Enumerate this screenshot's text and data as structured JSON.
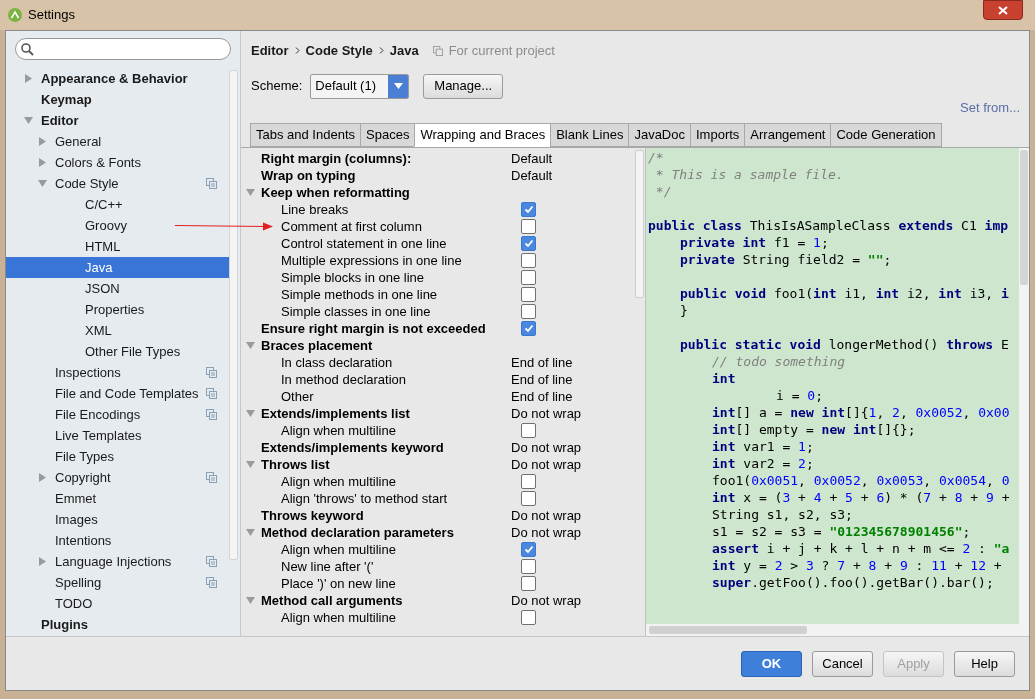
{
  "window": {
    "title": "Settings"
  },
  "sidebar": {
    "items": [
      {
        "label": "Appearance & Behavior",
        "expanded": false,
        "selected": false
      },
      {
        "label": "Keymap",
        "selected": false
      },
      {
        "label": "Editor",
        "expanded": true,
        "selected": false,
        "children": [
          {
            "label": "General",
            "expanded": false,
            "selected": false
          },
          {
            "label": "Colors & Fonts",
            "expanded": false,
            "selected": false
          },
          {
            "label": "Code Style",
            "expanded": true,
            "project_icon": true,
            "selected": false,
            "children": [
              {
                "label": "C/C++",
                "selected": false
              },
              {
                "label": "Groovy",
                "selected": false
              },
              {
                "label": "HTML",
                "selected": false
              },
              {
                "label": "Java",
                "selected": true
              },
              {
                "label": "JSON",
                "selected": false
              },
              {
                "label": "Properties",
                "selected": false
              },
              {
                "label": "XML",
                "selected": false
              },
              {
                "label": "Other File Types",
                "selected": false
              }
            ]
          },
          {
            "label": "Inspections",
            "project_icon": true,
            "selected": false
          },
          {
            "label": "File and Code Templates",
            "project_icon": true,
            "selected": false
          },
          {
            "label": "File Encodings",
            "project_icon": true,
            "selected": false
          },
          {
            "label": "Live Templates",
            "selected": false
          },
          {
            "label": "File Types",
            "selected": false
          },
          {
            "label": "Copyright",
            "expanded": false,
            "project_icon": true,
            "selected": false
          },
          {
            "label": "Emmet",
            "selected": false
          },
          {
            "label": "Images",
            "selected": false
          },
          {
            "label": "Intentions",
            "selected": false
          },
          {
            "label": "Language Injections",
            "expanded": false,
            "project_icon": true,
            "selected": false
          },
          {
            "label": "Spelling",
            "project_icon": true,
            "selected": false
          },
          {
            "label": "TODO",
            "selected": false
          }
        ]
      },
      {
        "label": "Plugins",
        "selected": false
      }
    ]
  },
  "breadcrumb": [
    "Editor",
    "Code Style",
    "Java"
  ],
  "scope_note": "For current project",
  "scheme": {
    "label": "Scheme:",
    "value": "Default (1)",
    "manage_button": "Manage..."
  },
  "set_from_link": "Set from...",
  "tabs": [
    {
      "label": "Tabs and Indents",
      "selected": false
    },
    {
      "label": "Spaces",
      "selected": false
    },
    {
      "label": "Wrapping and Braces",
      "selected": true
    },
    {
      "label": "Blank Lines",
      "selected": false
    },
    {
      "label": "JavaDoc",
      "selected": false
    },
    {
      "label": "Imports",
      "selected": false
    },
    {
      "label": "Arrangement",
      "selected": false
    },
    {
      "label": "Code Generation",
      "selected": false
    }
  ],
  "options": [
    {
      "kind": "value",
      "label": "Right margin (columns):",
      "value": "Default"
    },
    {
      "kind": "value",
      "label": "Wrap on typing",
      "value": "Default"
    },
    {
      "kind": "group",
      "label": "Keep when reformatting",
      "expanded": true,
      "children": [
        {
          "kind": "checkbox",
          "label": "Line breaks",
          "checked": true
        },
        {
          "kind": "checkbox",
          "label": "Comment at first column",
          "checked": false
        },
        {
          "kind": "checkbox",
          "label": "Control statement in one line",
          "checked": true
        },
        {
          "kind": "checkbox",
          "label": "Multiple expressions in one line",
          "checked": false
        },
        {
          "kind": "checkbox",
          "label": "Simple blocks in one line",
          "checked": false
        },
        {
          "kind": "checkbox",
          "label": "Simple methods in one line",
          "checked": false
        },
        {
          "kind": "checkbox",
          "label": "Simple classes in one line",
          "checked": false
        }
      ]
    },
    {
      "kind": "checkbox",
      "label": "Ensure right margin is not exceeded",
      "checked": true
    },
    {
      "kind": "group",
      "label": "Braces placement",
      "expanded": true,
      "children": [
        {
          "kind": "value",
          "label": "In class declaration",
          "value": "End of line"
        },
        {
          "kind": "value",
          "label": "In method declaration",
          "value": "End of line"
        },
        {
          "kind": "value",
          "label": "Other",
          "value": "End of line"
        }
      ]
    },
    {
      "kind": "group",
      "label": "Extends/implements list",
      "value": "Do not wrap",
      "expanded": true,
      "children": [
        {
          "kind": "checkbox",
          "label": "Align when multiline",
          "checked": false
        }
      ]
    },
    {
      "kind": "value",
      "label": "Extends/implements keyword",
      "value": "Do not wrap"
    },
    {
      "kind": "group",
      "label": "Throws list",
      "value": "Do not wrap",
      "expanded": true,
      "children": [
        {
          "kind": "checkbox",
          "label": "Align when multiline",
          "checked": false
        },
        {
          "kind": "checkbox",
          "label": "Align 'throws' to method start",
          "checked": false
        }
      ]
    },
    {
      "kind": "value",
      "label": "Throws keyword",
      "value": "Do not wrap"
    },
    {
      "kind": "group",
      "label": "Method declaration parameters",
      "value": "Do not wrap",
      "expanded": true,
      "children": [
        {
          "kind": "checkbox",
          "label": "Align when multiline",
          "checked": true
        },
        {
          "kind": "checkbox",
          "label": "New line after '('",
          "checked": false
        },
        {
          "kind": "checkbox",
          "label": "Place ')' on new line",
          "checked": false
        }
      ]
    },
    {
      "kind": "group",
      "label": "Method call arguments",
      "value": "Do not wrap",
      "expanded": true,
      "children": [
        {
          "kind": "checkbox",
          "label": "Align when multiline",
          "checked": false
        }
      ]
    }
  ],
  "code_lines": [
    {
      "kind": "code",
      "segments": [
        {
          "kind": "comment",
          "text": "/*"
        }
      ]
    },
    {
      "kind": "code",
      "segments": [
        {
          "kind": "comment",
          "text": " * This is a sample file."
        }
      ]
    },
    {
      "kind": "code",
      "segments": [
        {
          "kind": "comment",
          "text": " */"
        }
      ]
    },
    {
      "kind": "blank"
    },
    {
      "kind": "code",
      "segments": [
        {
          "kind": "keyword",
          "text": "public class "
        },
        {
          "kind": "plain",
          "text": "ThisIsASampleClass "
        },
        {
          "kind": "keyword",
          "text": "extends "
        },
        {
          "kind": "plain",
          "text": "C1 "
        },
        {
          "kind": "keyword",
          "text": "imp"
        }
      ]
    },
    {
      "kind": "indent1",
      "segments": [
        {
          "kind": "keyword",
          "text": "private int "
        },
        {
          "kind": "plain",
          "text": "f1 = "
        },
        {
          "kind": "number",
          "text": "1"
        },
        {
          "kind": "plain",
          "text": ";"
        }
      ]
    },
    {
      "kind": "indent1",
      "segments": [
        {
          "kind": "keyword",
          "text": "private "
        },
        {
          "kind": "plain",
          "text": "String field2 = "
        },
        {
          "kind": "string",
          "text": "\"\""
        },
        {
          "kind": "plain",
          "text": ";"
        }
      ]
    },
    {
      "kind": "blank"
    },
    {
      "kind": "indent1",
      "segments": [
        {
          "kind": "keyword",
          "text": "public void "
        },
        {
          "kind": "plain",
          "text": "foo1("
        },
        {
          "kind": "keyword",
          "text": "int "
        },
        {
          "kind": "plain",
          "text": "i1, "
        },
        {
          "kind": "keyword",
          "text": "int "
        },
        {
          "kind": "plain",
          "text": "i2, "
        },
        {
          "kind": "keyword",
          "text": "int "
        },
        {
          "kind": "plain",
          "text": "i3, "
        },
        {
          "kind": "keyword",
          "text": "i"
        }
      ]
    },
    {
      "kind": "indent1",
      "segments": [
        {
          "kind": "plain",
          "text": "}"
        }
      ]
    },
    {
      "kind": "blank"
    },
    {
      "kind": "indent1",
      "segments": [
        {
          "kind": "keyword",
          "text": "public static void "
        },
        {
          "kind": "plain",
          "text": "longerMethod() "
        },
        {
          "kind": "keyword",
          "text": "throws "
        },
        {
          "kind": "plain",
          "text": "E"
        }
      ]
    },
    {
      "kind": "indent2",
      "segments": [
        {
          "kind": "comment",
          "text": "// todo something"
        }
      ]
    },
    {
      "kind": "indent2",
      "segments": [
        {
          "kind": "keyword",
          "text": "int"
        }
      ]
    },
    {
      "kind": "indent4",
      "segments": [
        {
          "kind": "plain",
          "text": "i = "
        },
        {
          "kind": "number",
          "text": "0"
        },
        {
          "kind": "plain",
          "text": ";"
        }
      ]
    },
    {
      "kind": "indent2",
      "segments": [
        {
          "kind": "keyword",
          "text": "int"
        },
        {
          "kind": "plain",
          "text": "[] a = "
        },
        {
          "kind": "keyword",
          "text": "new int"
        },
        {
          "kind": "plain",
          "text": "[]{"
        },
        {
          "kind": "number",
          "text": "1"
        },
        {
          "kind": "plain",
          "text": ", "
        },
        {
          "kind": "number",
          "text": "2"
        },
        {
          "kind": "plain",
          "text": ", "
        },
        {
          "kind": "number",
          "text": "0x0052"
        },
        {
          "kind": "plain",
          "text": ", "
        },
        {
          "kind": "number",
          "text": "0x00"
        }
      ]
    },
    {
      "kind": "indent2",
      "segments": [
        {
          "kind": "keyword",
          "text": "int"
        },
        {
          "kind": "plain",
          "text": "[] empty = "
        },
        {
          "kind": "keyword",
          "text": "new int"
        },
        {
          "kind": "plain",
          "text": "[]{};"
        }
      ]
    },
    {
      "kind": "indent2",
      "segments": [
        {
          "kind": "keyword",
          "text": "int "
        },
        {
          "kind": "plain",
          "text": "var1 = "
        },
        {
          "kind": "number",
          "text": "1"
        },
        {
          "kind": "plain",
          "text": ";"
        }
      ]
    },
    {
      "kind": "indent2",
      "segments": [
        {
          "kind": "keyword",
          "text": "int "
        },
        {
          "kind": "plain",
          "text": "var2 = "
        },
        {
          "kind": "number",
          "text": "2"
        },
        {
          "kind": "plain",
          "text": ";"
        }
      ]
    },
    {
      "kind": "indent2",
      "segments": [
        {
          "kind": "plain",
          "text": "foo1("
        },
        {
          "kind": "number",
          "text": "0x0051"
        },
        {
          "kind": "plain",
          "text": ", "
        },
        {
          "kind": "number",
          "text": "0x0052"
        },
        {
          "kind": "plain",
          "text": ", "
        },
        {
          "kind": "number",
          "text": "0x0053"
        },
        {
          "kind": "plain",
          "text": ", "
        },
        {
          "kind": "number",
          "text": "0x0054"
        },
        {
          "kind": "plain",
          "text": ", "
        },
        {
          "kind": "number",
          "text": "0"
        }
      ]
    },
    {
      "kind": "indent2",
      "segments": [
        {
          "kind": "keyword",
          "text": "int "
        },
        {
          "kind": "plain",
          "text": "x = ("
        },
        {
          "kind": "number",
          "text": "3"
        },
        {
          "kind": "plain",
          "text": " + "
        },
        {
          "kind": "number",
          "text": "4"
        },
        {
          "kind": "plain",
          "text": " + "
        },
        {
          "kind": "number",
          "text": "5"
        },
        {
          "kind": "plain",
          "text": " + "
        },
        {
          "kind": "number",
          "text": "6"
        },
        {
          "kind": "plain",
          "text": ") * ("
        },
        {
          "kind": "number",
          "text": "7"
        },
        {
          "kind": "plain",
          "text": " + "
        },
        {
          "kind": "number",
          "text": "8"
        },
        {
          "kind": "plain",
          "text": " + "
        },
        {
          "kind": "number",
          "text": "9"
        },
        {
          "kind": "plain",
          "text": " +"
        }
      ]
    },
    {
      "kind": "indent2",
      "segments": [
        {
          "kind": "plain",
          "text": "String s1, s2, s3;"
        }
      ]
    },
    {
      "kind": "indent2",
      "segments": [
        {
          "kind": "plain",
          "text": "s1 = s2 = s3 = "
        },
        {
          "kind": "string",
          "text": "\"012345678901456\""
        },
        {
          "kind": "plain",
          "text": ";"
        }
      ]
    },
    {
      "kind": "indent2",
      "segments": [
        {
          "kind": "keyword",
          "text": "assert "
        },
        {
          "kind": "plain",
          "text": "i + j + k + l + n + m <= "
        },
        {
          "kind": "number",
          "text": "2"
        },
        {
          "kind": "plain",
          "text": " : "
        },
        {
          "kind": "string",
          "text": "\"a"
        }
      ]
    },
    {
      "kind": "indent2",
      "segments": [
        {
          "kind": "keyword",
          "text": "int "
        },
        {
          "kind": "plain",
          "text": "y = "
        },
        {
          "kind": "number",
          "text": "2"
        },
        {
          "kind": "plain",
          "text": " > "
        },
        {
          "kind": "number",
          "text": "3"
        },
        {
          "kind": "plain",
          "text": " ? "
        },
        {
          "kind": "number",
          "text": "7"
        },
        {
          "kind": "plain",
          "text": " + "
        },
        {
          "kind": "number",
          "text": "8"
        },
        {
          "kind": "plain",
          "text": " + "
        },
        {
          "kind": "number",
          "text": "9"
        },
        {
          "kind": "plain",
          "text": " : "
        },
        {
          "kind": "number",
          "text": "11"
        },
        {
          "kind": "plain",
          "text": " + "
        },
        {
          "kind": "number",
          "text": "12"
        },
        {
          "kind": "plain",
          "text": " +"
        }
      ]
    },
    {
      "kind": "indent2",
      "segments": [
        {
          "kind": "keyword",
          "text": "super"
        },
        {
          "kind": "plain",
          "text": ".getFoo().foo().getBar().bar();"
        }
      ]
    }
  ],
  "buttons": [
    {
      "label": "OK",
      "kind": "primary",
      "disabled": false
    },
    {
      "label": "Cancel",
      "kind": "normal",
      "disabled": false
    },
    {
      "label": "Apply",
      "kind": "normal",
      "disabled": true
    },
    {
      "label": "Help",
      "kind": "normal",
      "disabled": false
    }
  ]
}
